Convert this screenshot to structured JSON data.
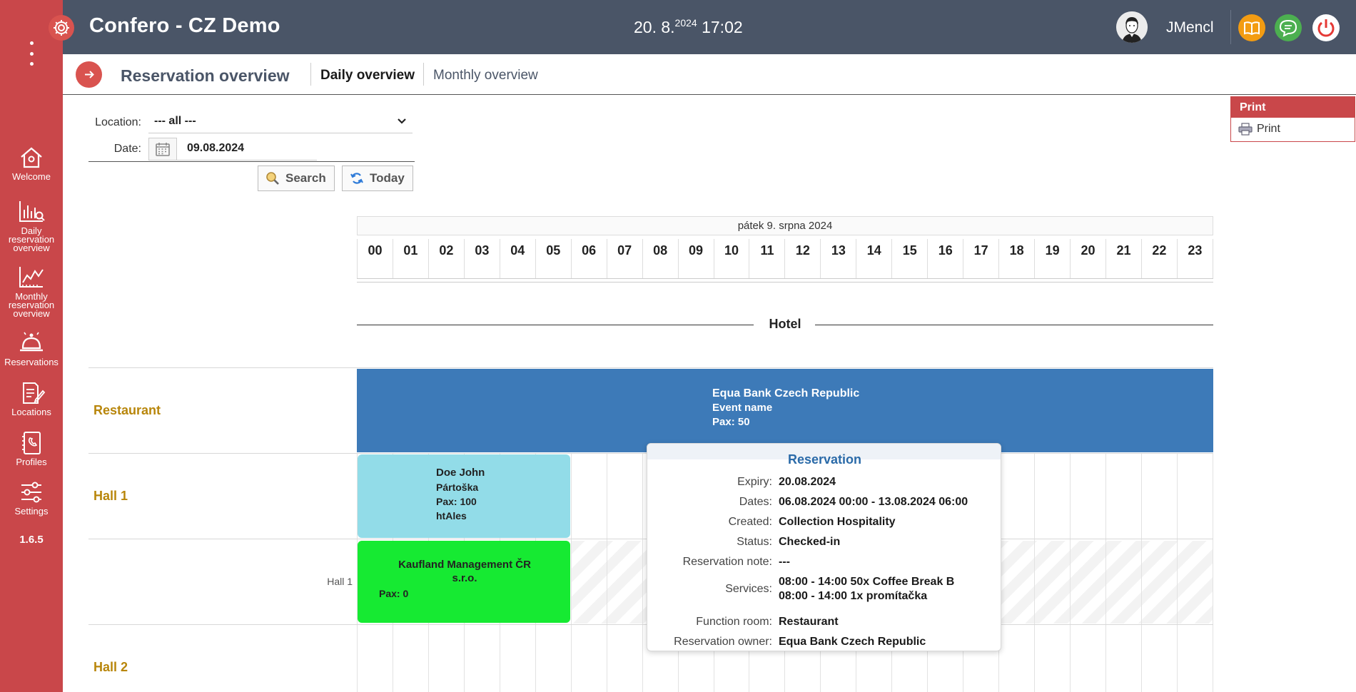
{
  "app": {
    "title": "Confero - CZ Demo",
    "clock_date": "20. 8.",
    "clock_year": "2024",
    "clock_time": "17:02",
    "username": "JMencl"
  },
  "colors": {
    "sidebar": "#c9474a",
    "topbar": "#4a5567",
    "accent_blue": "#3d7ab8",
    "label_gold": "#b8860b"
  },
  "sidebar": {
    "items": [
      {
        "label": "Welcome",
        "icon": "home-icon"
      },
      {
        "label": "Daily reservation overview",
        "icon": "daily-chart-icon"
      },
      {
        "label": "Monthly reservation overview",
        "icon": "monthly-chart-icon"
      },
      {
        "label": "Reservations",
        "icon": "bell-icon"
      },
      {
        "label": "Locations",
        "icon": "document-edit-icon"
      },
      {
        "label": "Profiles",
        "icon": "profile-book-icon"
      },
      {
        "label": "Settings",
        "icon": "sliders-icon"
      }
    ],
    "version": "1.6.5"
  },
  "subheader": {
    "title": "Reservation overview",
    "tabs": [
      "Daily overview",
      "Monthly overview"
    ]
  },
  "print": {
    "header": "Print",
    "link": "Print"
  },
  "form": {
    "location_label": "Location:",
    "location_value": "--- all ---",
    "date_label": "Date:",
    "date_value": "09.08.2024",
    "search_label": "Search",
    "today_label": "Today"
  },
  "timeline": {
    "day_title": "pátek 9. srpna 2024",
    "hours": [
      "00",
      "01",
      "02",
      "03",
      "04",
      "05",
      "06",
      "07",
      "08",
      "09",
      "10",
      "11",
      "12",
      "13",
      "14",
      "15",
      "16",
      "17",
      "18",
      "19",
      "20",
      "21",
      "22",
      "23"
    ],
    "section": "Hotel"
  },
  "rows": {
    "restaurant": "Restaurant",
    "hall1": "Hall 1",
    "hall1_sub": "Hall 1",
    "hall2": "Hall 2"
  },
  "reservations": {
    "equa": {
      "name": "Equa Bank Czech Republic",
      "line2": "Event name",
      "pax": "Pax: 50"
    },
    "doe": {
      "name": "Doe John",
      "line2": "Pártoška",
      "pax": "Pax: 100",
      "line4": "htAles"
    },
    "kaufland": {
      "name_1": "Kaufland Management ČR",
      "name_2": "s.r.o.",
      "pax": "Pax: 0"
    }
  },
  "tooltip": {
    "title": "Reservation",
    "rows": [
      {
        "k": "Expiry:",
        "v": "20.08.2024"
      },
      {
        "k": "Dates:",
        "v": "06.08.2024 00:00 - 13.08.2024 06:00"
      },
      {
        "k": "Created:",
        "v": "Collection Hospitality"
      },
      {
        "k": "Status:",
        "v": "Checked-in"
      },
      {
        "k": "Reservation note:",
        "v": "---"
      },
      {
        "k": "Services:",
        "v": "08:00 - 14:00 50x Coffee Break B",
        "v2": "08:00 - 14:00 1x promítačka"
      },
      {
        "k": "Function room:",
        "v": "Restaurant"
      },
      {
        "k": "Reservation owner:",
        "v": "Equa Bank Czech Republic"
      }
    ]
  }
}
